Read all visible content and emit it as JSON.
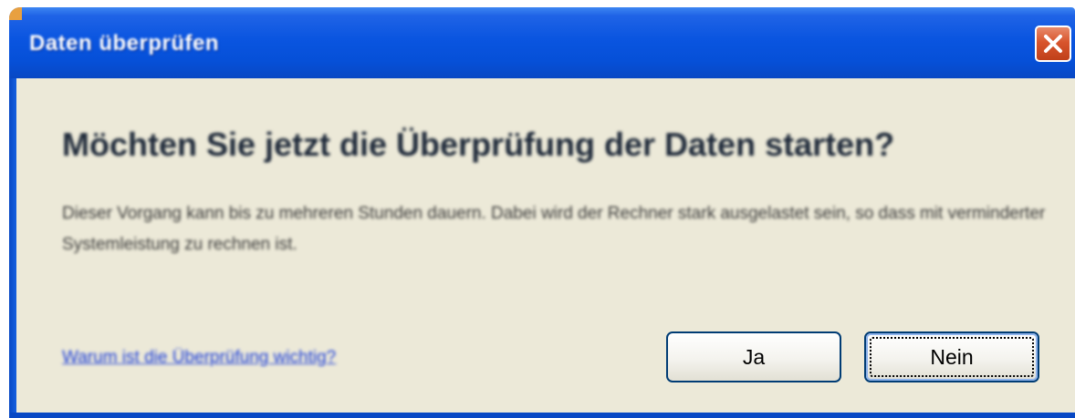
{
  "window": {
    "title": "Daten überprüfen",
    "close_icon": "close-icon"
  },
  "dialog": {
    "heading": "Möchten Sie jetzt die Überprüfung der Daten starten?",
    "description": "Dieser Vorgang kann bis zu mehreren Stunden dauern. Dabei wird der Rechner stark ausgelastet sein, so dass mit verminderter Systemleistung zu rechnen ist.",
    "help_link": "Warum ist die Überprüfung wichtig?"
  },
  "buttons": {
    "yes_label": "Ja",
    "no_label": "Nein"
  },
  "colors": {
    "titlebar": "#0a55e0",
    "dialog_background": "#ece9d8",
    "close_button": "#d8552c",
    "link": "#1d3fd8"
  }
}
